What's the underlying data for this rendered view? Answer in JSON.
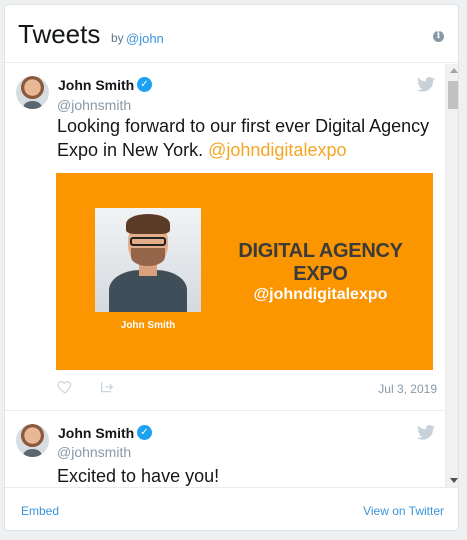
{
  "header": {
    "title": "Tweets",
    "by": "by",
    "handle": "@john",
    "info_icon": "info-icon"
  },
  "tweets": [
    {
      "name": "John Smith",
      "username": "@johnsmith",
      "verified_icon": "verified-badge-icon",
      "text": "Looking forward to our first ever Digital Agency Expo in New York.",
      "mention": "@johndigitalexpo",
      "media": {
        "photo_caption": "John Smith",
        "title_line1": "DIGITAL AGENCY",
        "title_line2": "EXPO",
        "handle": "@johndigitalexpo",
        "background_color": "#fb9500"
      },
      "date": "Jul 3, 2019"
    },
    {
      "name": "John Smith",
      "username": "@johnsmith",
      "verified_icon": "verified-badge-icon",
      "text": "Excited to have you!"
    }
  ],
  "footer": {
    "embed": "Embed",
    "view_on_twitter": "View on Twitter"
  },
  "colors": {
    "link": "#3b94d9",
    "verified": "#1da1f2",
    "mention": "#f5a623",
    "muted": "#8899a6"
  }
}
